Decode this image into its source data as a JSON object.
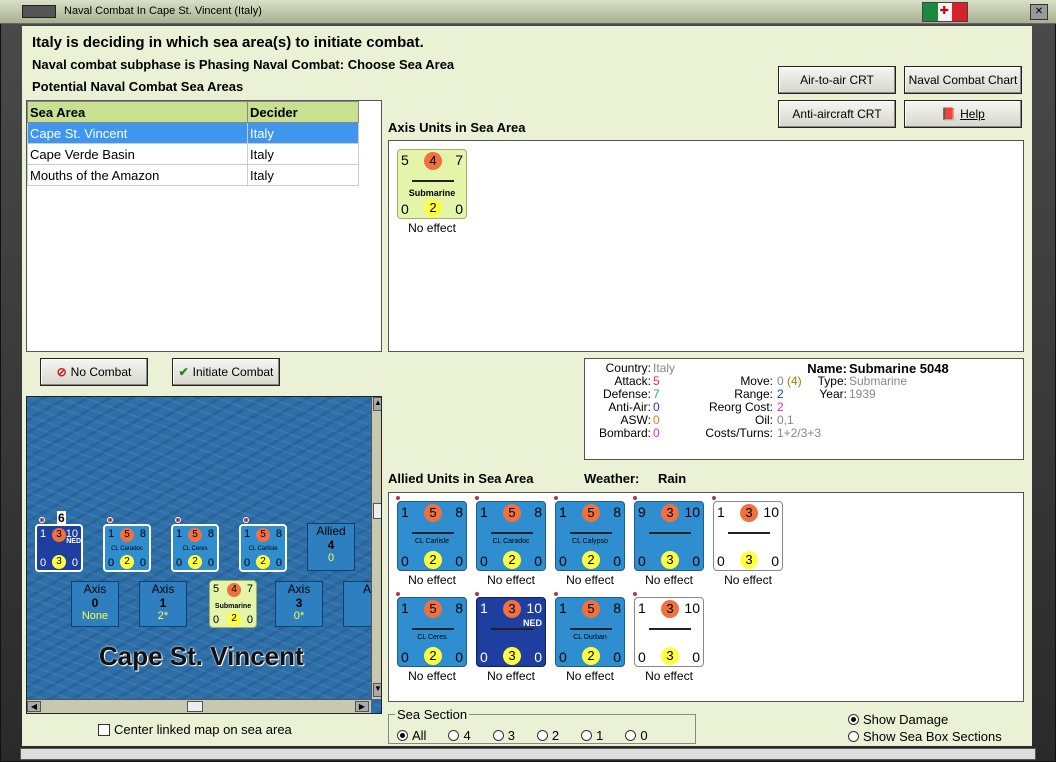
{
  "window": {
    "title": "Naval Combat In Cape St. Vincent (Italy)"
  },
  "header": {
    "line1": "Italy is deciding in which sea area(s) to initiate combat.",
    "line2": "Naval combat subphase is Phasing Naval Combat: Choose Sea Area",
    "line3": "Potential Naval Combat Sea Areas"
  },
  "buttons": {
    "air_to_air": "Air-to-air CRT",
    "naval_chart": "Naval Combat Chart",
    "anti_aircraft": "Anti-aircraft CRT",
    "help": "Help",
    "no_combat": "No Combat",
    "initiate_combat": "Initiate Combat"
  },
  "sea_table": {
    "headers": [
      "Sea Area",
      "Decider"
    ],
    "rows": [
      {
        "area": "Cape St. Vincent",
        "decider": "Italy",
        "selected": true
      },
      {
        "area": "Cape Verde Basin",
        "decider": "Italy",
        "selected": false
      },
      {
        "area": "Mouths of the Amazon",
        "decider": "Italy",
        "selected": false
      }
    ]
  },
  "axis_panel": {
    "label": "Axis Units in Sea Area",
    "units": [
      {
        "tl": "5",
        "tc": "4",
        "tr": "7",
        "name": "Submarine",
        "bl": "0",
        "bc": "2",
        "br": "0",
        "effect": "No effect"
      }
    ]
  },
  "info": {
    "country_label": "Country:",
    "country": "Italy",
    "attack_label": "Attack:",
    "attack": "5",
    "defense_label": "Defense:",
    "defense": "7",
    "antiair_label": "Anti-Air:",
    "antiair": "0",
    "asw_label": "ASW:",
    "asw": "0",
    "bombard_label": "Bombard:",
    "bombard": "0",
    "name_label": "Name:",
    "name": "Submarine 5048",
    "move_label": "Move:",
    "move": "0",
    "move_extra": "(4)",
    "range_label": "Range:",
    "range": "2",
    "reorg_label": "Reorg Cost:",
    "reorg": "2",
    "oil_label": "Oil:",
    "oil": "0,1",
    "costs_label": "Costs/Turns:",
    "costs": "1+2/3+3",
    "type_label": "Type:",
    "type": "Submarine",
    "year_label": "Year:",
    "year": "1939"
  },
  "allied_panel": {
    "label": "Allied Units in Sea Area",
    "weather_label": "Weather:",
    "weather": "Rain",
    "units": [
      {
        "tl": "1",
        "tc": "5",
        "tr": "8",
        "name": "CL Carlisle",
        "bl": "0",
        "bc": "2",
        "br": "0",
        "effect": "No effect",
        "style": "blue"
      },
      {
        "tl": "1",
        "tc": "5",
        "tr": "8",
        "name": "CL Caradoc",
        "bl": "0",
        "bc": "2",
        "br": "0",
        "effect": "No effect",
        "style": "blue"
      },
      {
        "tl": "1",
        "tc": "5",
        "tr": "8",
        "name": "CL Calypso",
        "bl": "0",
        "bc": "2",
        "br": "0",
        "effect": "No effect",
        "style": "blue"
      },
      {
        "tl": "9",
        "tc": "3",
        "tr": "10",
        "name": "",
        "bl": "0",
        "bc": "3",
        "br": "0",
        "effect": "No effect",
        "style": "blue"
      },
      {
        "tl": "1",
        "tc": "3",
        "tr": "10",
        "name": "",
        "bl": "0",
        "bc": "3",
        "br": "0",
        "effect": "No effect",
        "style": "white"
      },
      {
        "tl": "1",
        "tc": "5",
        "tr": "8",
        "name": "CL Ceres",
        "bl": "0",
        "bc": "2",
        "br": "0",
        "effect": "No effect",
        "style": "blue"
      },
      {
        "tl": "1",
        "tc": "3",
        "tr": "10",
        "name": "NED",
        "bl": "0",
        "bc": "3",
        "br": "0",
        "effect": "No effect",
        "style": "navy"
      },
      {
        "tl": "1",
        "tc": "5",
        "tr": "8",
        "name": "CL Durban",
        "bl": "0",
        "bc": "2",
        "br": "0",
        "effect": "No effect",
        "style": "blue"
      },
      {
        "tl": "1",
        "tc": "3",
        "tr": "10",
        "name": "",
        "bl": "0",
        "bc": "3",
        "br": "0",
        "effect": "No effect",
        "style": "white"
      }
    ]
  },
  "map": {
    "title": "Cape St. Vincent",
    "stack_count": "6",
    "allied_label": "Allied",
    "allied_value": "4",
    "allied_sub": "0",
    "map_counters": [
      {
        "tl": "1",
        "tc": "3",
        "tr": "10",
        "name": "NED",
        "bl": "0",
        "bc": "3",
        "br": "0"
      },
      {
        "tl": "1",
        "tc": "5",
        "tr": "8",
        "name": "CL Caradoc",
        "bl": "0",
        "bc": "2",
        "br": "0"
      },
      {
        "tl": "1",
        "tc": "5",
        "tr": "8",
        "name": "CL Ceres",
        "bl": "0",
        "bc": "2",
        "br": "0"
      },
      {
        "tl": "1",
        "tc": "5",
        "tr": "8",
        "name": "CL Carlisle",
        "bl": "0",
        "bc": "2",
        "br": "0"
      }
    ],
    "axis_boxes": [
      {
        "label": "Axis",
        "value": "0",
        "sub": "None"
      },
      {
        "label": "Axis",
        "value": "1",
        "sub": "2*"
      },
      {
        "label": "Axis",
        "value": "3",
        "sub": "0*"
      },
      {
        "label": "A",
        "value": "",
        "sub": ""
      }
    ],
    "sub_counter": {
      "tl": "5",
      "tc": "4",
      "tr": "7",
      "name": "Submarine",
      "bl": "0",
      "bc": "2",
      "br": "0"
    }
  },
  "options": {
    "center_map": "Center linked map on sea area",
    "sea_section_label": "Sea Section",
    "sea_sections": [
      "All",
      "4",
      "3",
      "2",
      "1",
      "0"
    ],
    "show_damage": "Show Damage",
    "show_sea_box": "Show Sea Box Sections"
  },
  "colors": {
    "panel_bg": "#eaf1d4",
    "header_green": "#c8e090",
    "selection": "#3e96ee",
    "counter_blue": "#2e8ecf"
  }
}
